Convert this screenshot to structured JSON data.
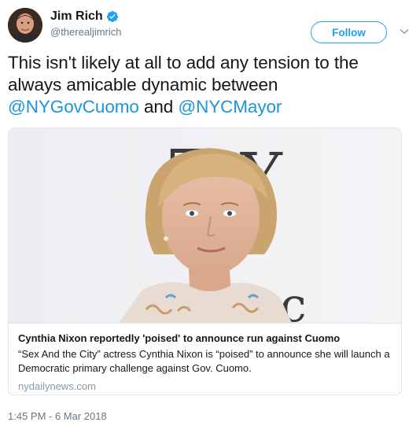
{
  "author": {
    "display_name": "Jim Rich",
    "handle": "@therealjimrich",
    "verified": true
  },
  "actions": {
    "follow_label": "Follow",
    "menu_icon": "chevron-down-icon"
  },
  "tweet": {
    "text_intro": "This isn't likely at all to add any tension to the always amicable dynamic between ",
    "mention_1": "@NYGovCuomo",
    "text_join": " and ",
    "mention_2": "@NYCMayor"
  },
  "card": {
    "title": "Cynthia Nixon reportedly 'poised' to announce run against Cuomo",
    "description": "“Sex And the City” actress Cynthia Nixon is “poised” to announce she will launch a Democratic primary challenge against Gov. Cuomo.",
    "domain": "nydailynews.com"
  },
  "timestamp": "1:45 PM - 6 Mar 2018",
  "colors": {
    "accent": "#1da1f2",
    "mention": "#1b95e0",
    "muted": "#657786"
  }
}
